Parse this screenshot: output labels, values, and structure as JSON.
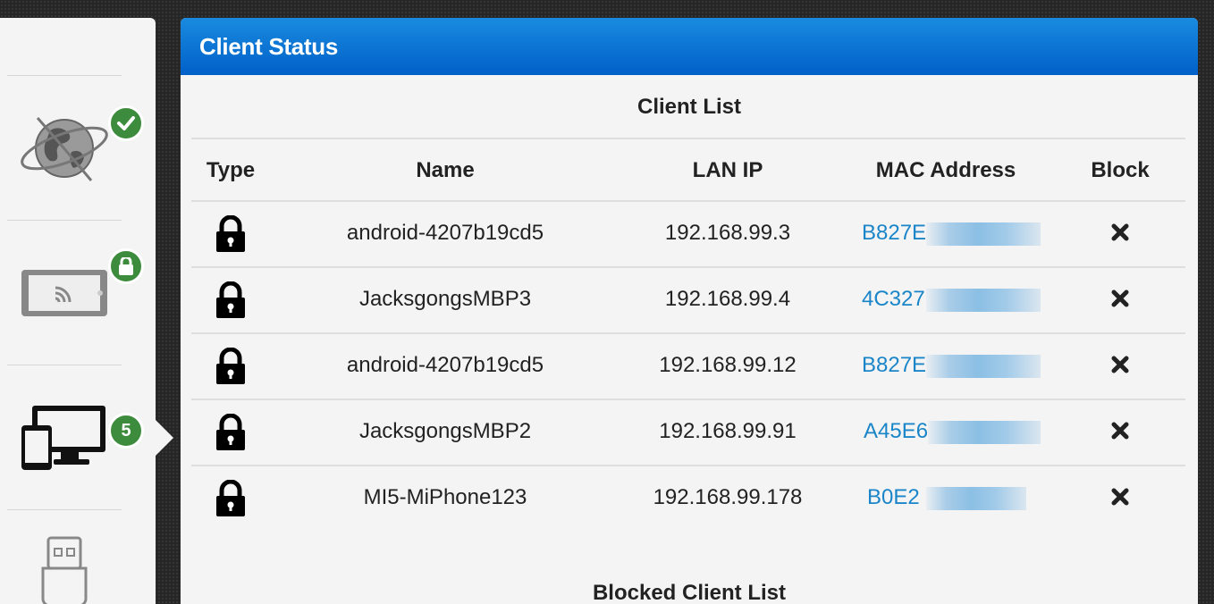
{
  "sidebar": {
    "internet_status_icon": "check-icon",
    "wireless_status_icon": "lock-icon",
    "clients_badge_count": "5",
    "items": [
      {
        "name": "internet-status",
        "icon": "globe-icon"
      },
      {
        "name": "wireless",
        "icon": "tablet-wifi-icon"
      },
      {
        "name": "clients",
        "icon": "devices-icon"
      },
      {
        "name": "usb",
        "icon": "usb-icon"
      }
    ]
  },
  "panel": {
    "title": "Client Status",
    "client_list_title": "Client List",
    "blocked_list_title": "Blocked Client List",
    "columns": [
      "Type",
      "Name",
      "LAN IP",
      "MAC Address",
      "Block"
    ],
    "rows": [
      {
        "type_icon": "lock-icon",
        "name": "android-4207b19cd5",
        "ip": "192.168.99.3",
        "mac": "B827E"
      },
      {
        "type_icon": "lock-icon",
        "name": "JacksgongsMBP3",
        "ip": "192.168.99.4",
        "mac": "4C327"
      },
      {
        "type_icon": "lock-icon",
        "name": "android-4207b19cd5",
        "ip": "192.168.99.12",
        "mac": "B827E"
      },
      {
        "type_icon": "lock-icon",
        "name": "JacksgongsMBP2",
        "ip": "192.168.99.91",
        "mac": "A45E6"
      },
      {
        "type_icon": "lock-icon",
        "name": "MI5-MiPhone123",
        "ip": "192.168.99.178",
        "mac": "B0E2"
      }
    ]
  },
  "colors": {
    "header_gradient_top": "#1a8be0",
    "header_gradient_bottom": "#0060c8",
    "badge_green": "#3d8b3d",
    "mac_link": "#1a85c8"
  }
}
